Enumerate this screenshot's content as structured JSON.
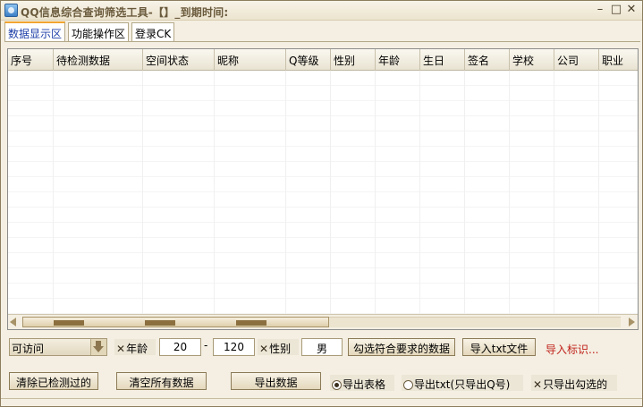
{
  "window": {
    "title": "QQ信息综合查询筛选工具-【】_到期时间:"
  },
  "window_controls": {
    "minimize": "–",
    "maximize": "□",
    "close": "✕"
  },
  "tabs": [
    {
      "label": "数据显示区",
      "active": true
    },
    {
      "label": "功能操作区",
      "active": false
    },
    {
      "label": "登录CK",
      "active": false
    }
  ],
  "table": {
    "columns": [
      "序号",
      "待检测数据",
      "空间状态",
      "昵称",
      "Q等级",
      "性别",
      "年龄",
      "生日",
      "签名",
      "学校",
      "公司",
      "职业"
    ],
    "rows": []
  },
  "filters": {
    "access_select": "可访问",
    "age_label": "年龄",
    "age_checked": true,
    "age_min": "20",
    "age_separator": "-",
    "age_max": "120",
    "gender_label": "性别",
    "gender_checked": true,
    "gender_value": "男",
    "select_matching_button": "勾选符合要求的数据",
    "import_txt_button": "导入txt文件",
    "import_mark_link": "导入标识..."
  },
  "actions": {
    "clear_checked_button": "清除已检测过的",
    "clear_all_button": "清空所有数据",
    "export_button": "导出数据",
    "export_table_option": "导出表格",
    "export_txt_option": "导出txt(只导出Q号)",
    "export_selected_only": "只导出勾选的",
    "export_mode": "table",
    "export_selected_checked": true
  },
  "colors": {
    "accent_tab": "#1e3fa8",
    "link_red": "#c0201b",
    "window_bg": "#f4efe2"
  }
}
